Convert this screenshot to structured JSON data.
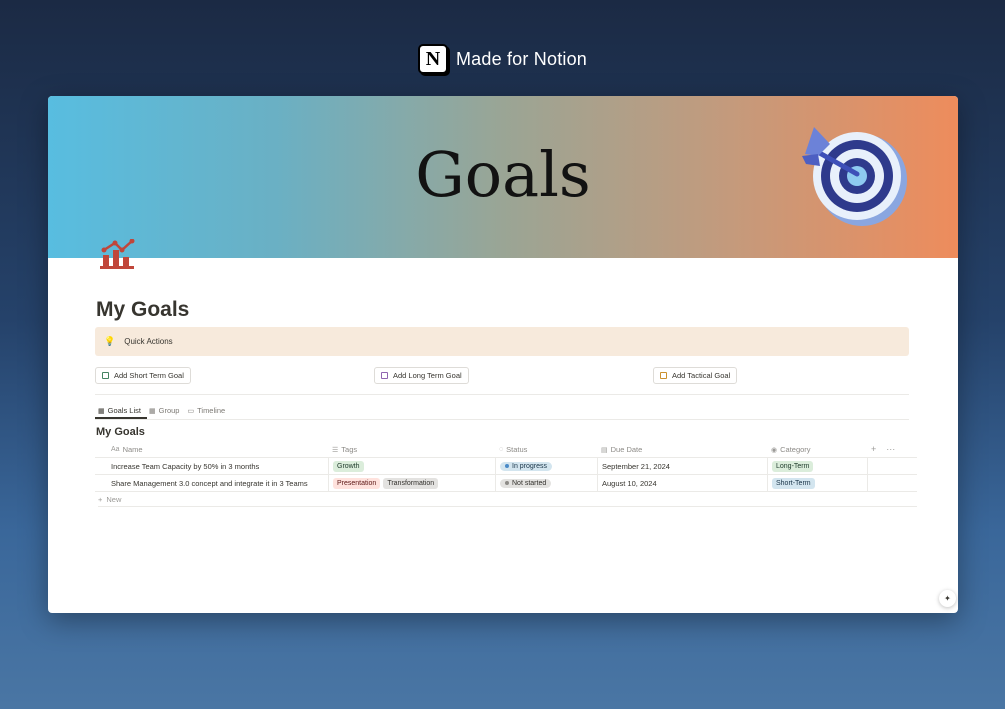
{
  "brand": {
    "logo_letter": "N",
    "text": "Made for Notion"
  },
  "cover": {
    "title": "Goals",
    "gradient_colors": [
      "#58bde0",
      "#9aa595",
      "#ee8c5c"
    ],
    "target_icon": "target-dart-icon",
    "page_icon": "bar-chart-icon"
  },
  "page": {
    "title": "My Goals"
  },
  "callout": {
    "icon": "lightbulb-icon",
    "text": "Quick Actions"
  },
  "quick_actions": [
    {
      "label": "Add Short Term Goal",
      "color": "#448361"
    },
    {
      "label": "Add Long Term Goal",
      "color": "#9065b0"
    },
    {
      "label": "Add Tactical Goal",
      "color": "#cb912f"
    }
  ],
  "tabs": [
    {
      "label": "Goals List",
      "icon": "table-icon",
      "active": true
    },
    {
      "label": "Group",
      "icon": "table-icon",
      "active": false
    },
    {
      "label": "Timeline",
      "icon": "timeline-icon",
      "active": false
    }
  ],
  "database": {
    "title": "My Goals",
    "columns": {
      "name": "Name",
      "tags": "Tags",
      "status": "Status",
      "due": "Due Date",
      "category": "Category"
    },
    "rows": [
      {
        "name": "Increase Team Capacity by 50% in 3 months",
        "tags": [
          "Growth"
        ],
        "status": "In progress",
        "due": "September 21, 2024",
        "category": "Long-Term"
      },
      {
        "name": "Share Management 3.0 concept and integrate it in 3 Teams",
        "tags": [
          "Presentation",
          "Transformation"
        ],
        "status": "Not started",
        "due": "August 10, 2024",
        "category": "Short-Term"
      }
    ],
    "new_label": "New",
    "name_icon_text": "Aa"
  }
}
